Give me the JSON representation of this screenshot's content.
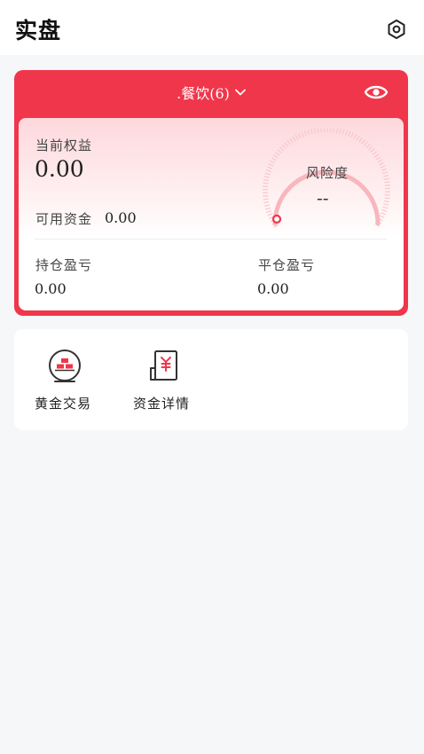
{
  "header": {
    "title": "实盘",
    "settings_icon": "gear-hexagon-icon"
  },
  "account": {
    "name": ".餐饮(6)",
    "accent_color": "#f0364a",
    "equity_label": "当前权益",
    "equity_value": "0.00",
    "available_label": "可用资金",
    "available_value": "0.00",
    "risk_label": "风险度",
    "risk_value": "--",
    "position_pnl_label": "持仓盈亏",
    "position_pnl_value": "0.00",
    "closed_pnl_label": "平仓盈亏",
    "closed_pnl_value": "0.00"
  },
  "menu": {
    "items": [
      {
        "label": "黄金交易",
        "icon": "gold-bars-icon"
      },
      {
        "label": "资金详情",
        "icon": "fund-document-icon"
      }
    ]
  }
}
